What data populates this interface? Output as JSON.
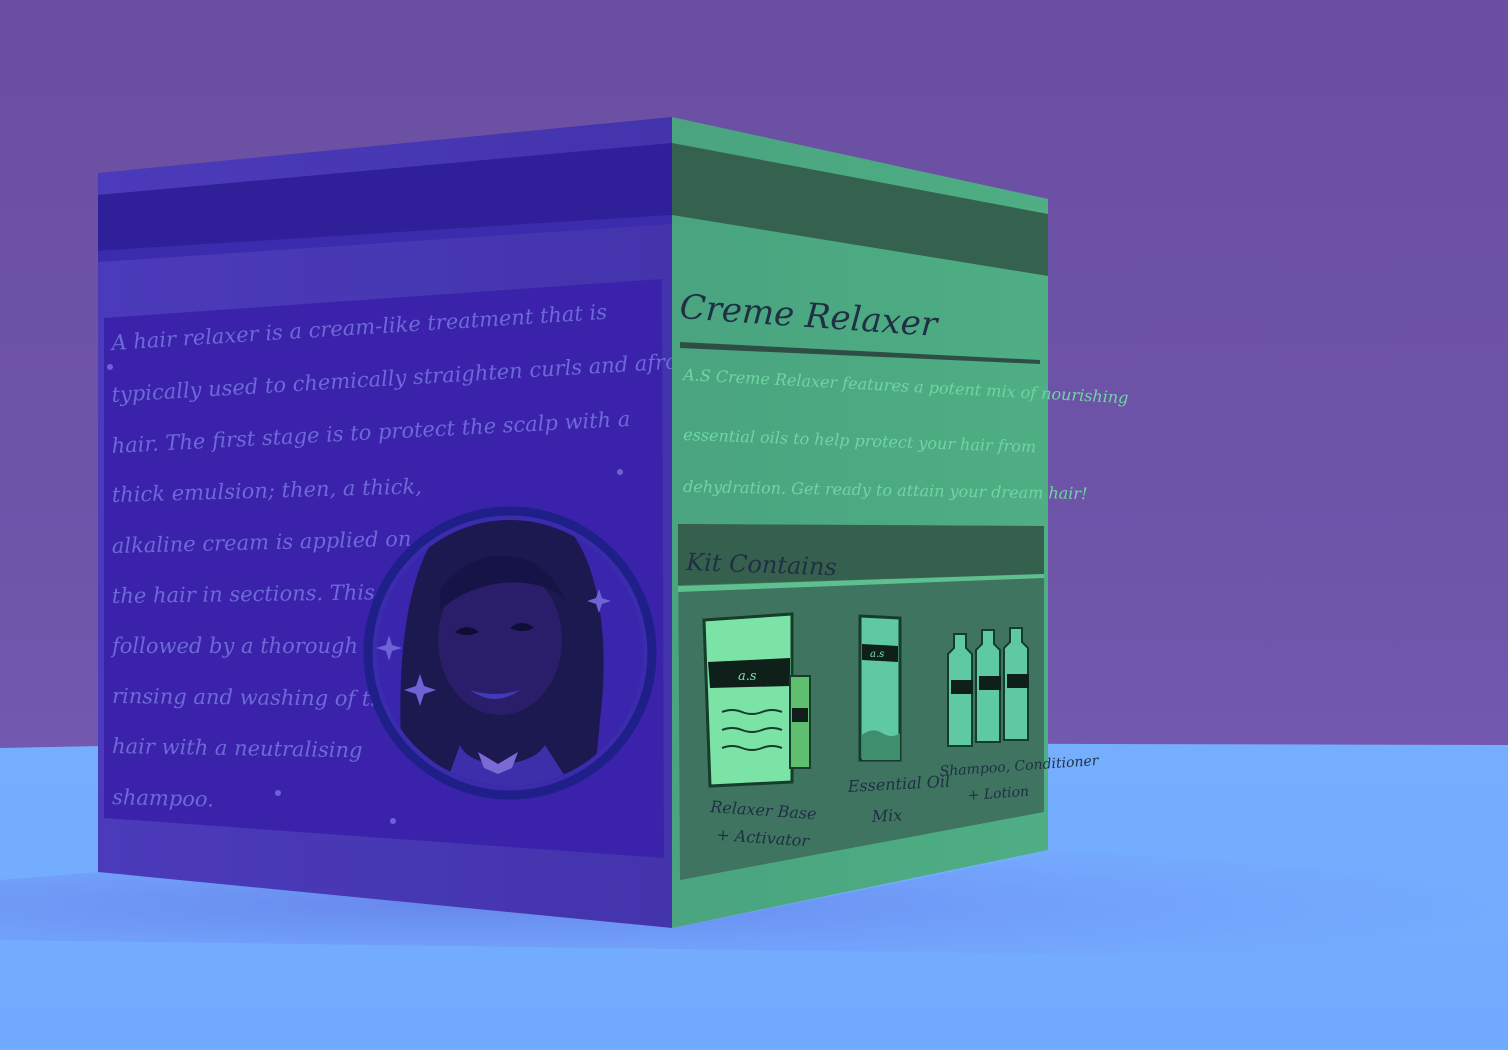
{
  "left_panel": {
    "lines": [
      "A hair relaxer is a cream-like treatment that is",
      "typically used to chemically straighten curls and afro",
      "hair. The first stage is to protect the scalp with a",
      "thick emulsion; then, a thick,",
      "alkaline cream is applied on",
      "the hair in sections. This is",
      "followed by a thorough",
      "rinsing and washing of the",
      "hair with a neutralising",
      "shampoo."
    ]
  },
  "right_panel": {
    "title": "Creme Relaxer",
    "desc_lines": [
      "A.S Creme Relaxer features a potent mix of nourishing",
      "essential oils to help protect your hair from",
      "dehydration. Get ready to attain your dream hair!"
    ],
    "kit_heading": "Kit Contains",
    "kit_items": [
      {
        "line1": "Relaxer Base",
        "line2": "+ Activator"
      },
      {
        "line1": "Essential Oil",
        "line2": "Mix"
      },
      {
        "line1": "Shampoo, Conditioner",
        "line2": "+ Lotion"
      }
    ],
    "brand_mark": "a.s"
  },
  "colors": {
    "background_top": "#6a4ea2",
    "floor": "#73abff",
    "box_left_face": "#4537b2",
    "box_right_face": "#4aa77f",
    "dark_band": "#2f1f99",
    "right_dark_band": "#35624f"
  }
}
